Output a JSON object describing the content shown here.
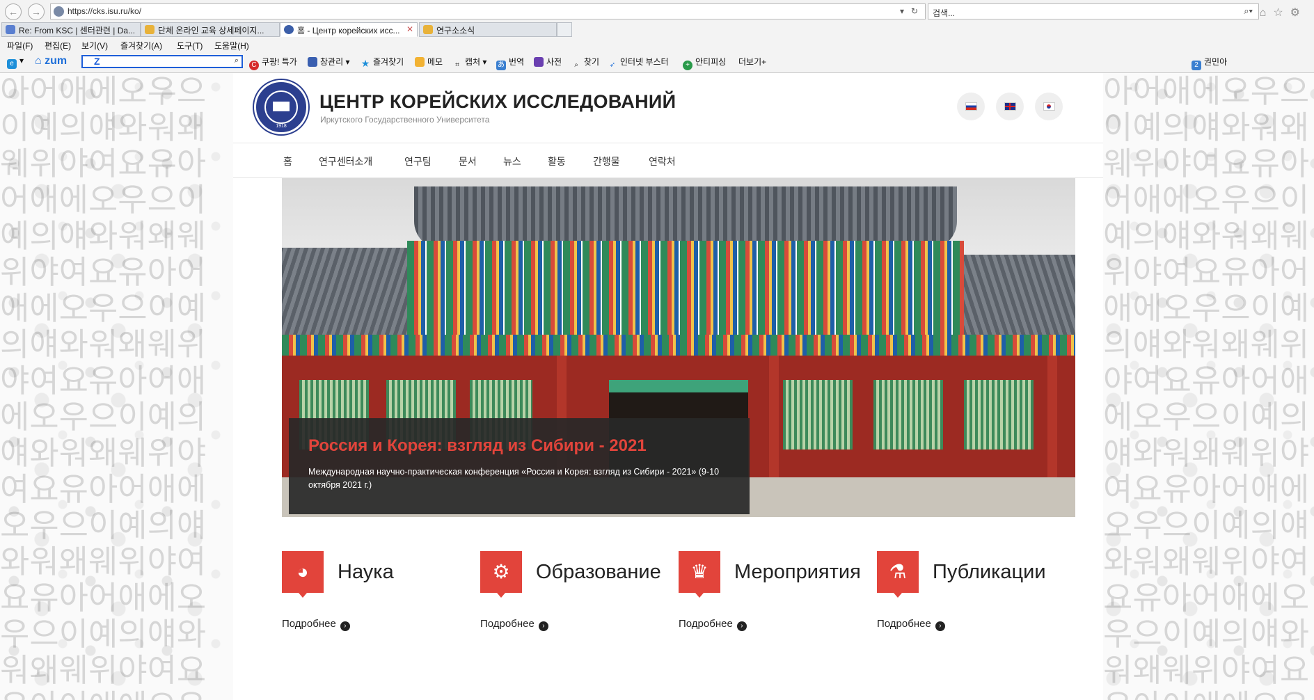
{
  "browser": {
    "url": "https://cks.isu.ru/ko/",
    "search_placeholder": "검색...",
    "tabs": [
      {
        "label": "Re: From KSC | 센터관련 | Da...",
        "fav": "#5a7fd0"
      },
      {
        "label": "단체 온라인 교육 상세페이지...",
        "fav": "#e8b23a"
      },
      {
        "label": "홈 - Центр корейских исс...",
        "fav": "#3b5ea8"
      },
      {
        "label": "연구소소식",
        "fav": "#e8b23a"
      }
    ],
    "menu": [
      "파일(F)",
      "편집(E)",
      "보기(V)",
      "즐겨찾기(A)",
      "도구(T)",
      "도움말(H)"
    ],
    "toolbar": {
      "zum": "zum",
      "items": [
        "쿠팡! 특가",
        "창관리",
        "즐겨찾기",
        "메모",
        "캡처",
        "번역",
        "사전",
        "찾기",
        "인터넷 부스터",
        "안티피싱",
        "더보기+"
      ],
      "user": "권민아"
    },
    "colors": {
      "accent": "#1e5fd9"
    }
  },
  "site": {
    "title": "ЦЕНТР КОРЕЙСКИХ ИССЛЕДОВАНИЙ",
    "subtitle": "Иркутского Государственного Университета",
    "logo_year": "1918",
    "languages": [
      "ru",
      "en",
      "ko"
    ],
    "nav": [
      "홈",
      "연구센터소개",
      "연구팀",
      "문서",
      "뉴스",
      "활동",
      "간행물",
      "연락처"
    ],
    "slider": {
      "title": "Россия и Корея: взгляд из Сибири - 2021",
      "text": "Международная научно-практическая конференция «Россия и Корея: взгляд из Сибири - 2021» (9-10 октября 2021 г.)"
    },
    "features": [
      {
        "title": "Наука",
        "icon": "globe-icon",
        "more": "Подробнее"
      },
      {
        "title": "Образование",
        "icon": "gear-icon",
        "more": "Подробнее"
      },
      {
        "title": "Мероприятия",
        "icon": "trophy-icon",
        "more": "Подробнее"
      },
      {
        "title": "Публикации",
        "icon": "flask-icon",
        "more": "Подробнее"
      }
    ],
    "colors": {
      "accent": "#e2443b",
      "caption_bg": "#2b2b2b"
    }
  }
}
